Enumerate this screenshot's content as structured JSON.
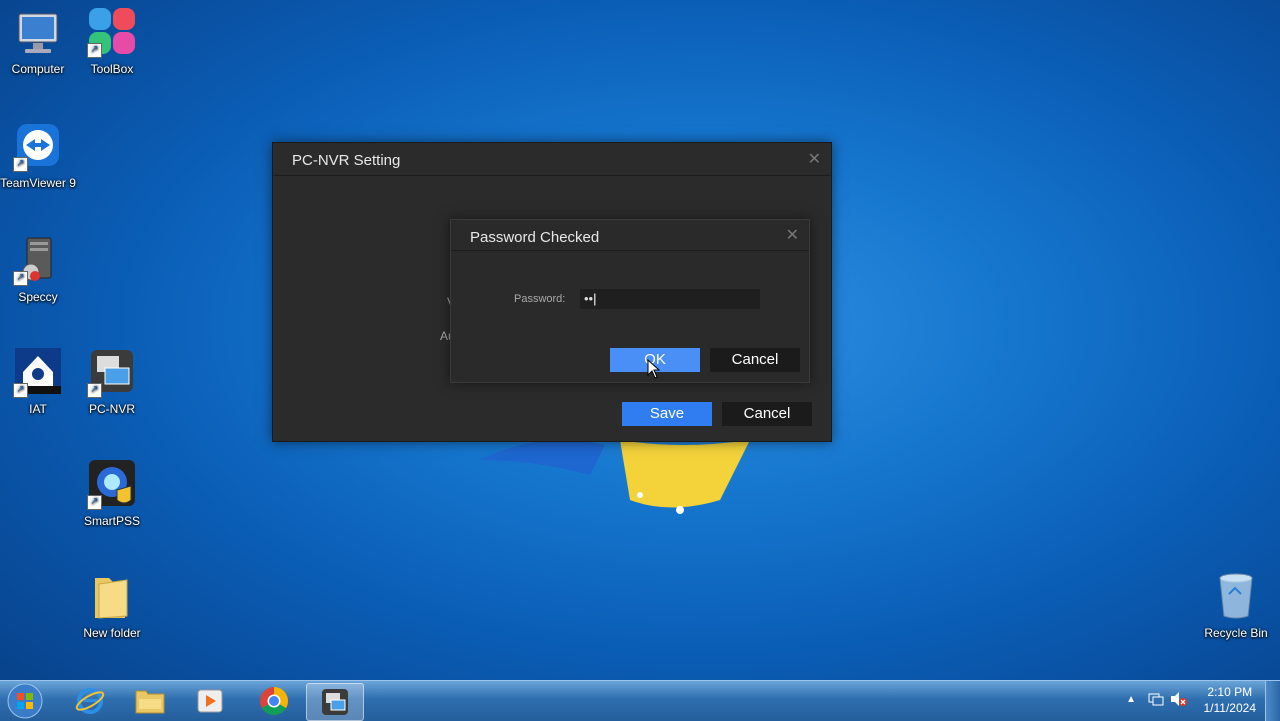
{
  "desktop": {
    "icons": [
      {
        "label": "Computer"
      },
      {
        "label": "ToolBox"
      },
      {
        "label": "TeamViewer 9"
      },
      {
        "label": "Speccy"
      },
      {
        "label": "IAT"
      },
      {
        "label": "PC-NVR"
      },
      {
        "label": "SmartPSS"
      },
      {
        "label": "New folder"
      },
      {
        "label": "Recycle Bin"
      }
    ]
  },
  "nvr_dialog": {
    "title": "PC-NVR Setting",
    "save_label": "Save",
    "cancel_label": "Cancel",
    "partial_labels": [
      "V",
      "Au"
    ]
  },
  "password_dialog": {
    "title": "Password Checked",
    "password_label": "Password:",
    "password_value": "••",
    "ok_label": "OK",
    "cancel_label": "Cancel"
  },
  "taskbar": {
    "apps": [
      "start-button",
      "internet-explorer",
      "windows-explorer",
      "media-player",
      "chrome",
      "pc-nvr"
    ],
    "active_app": "pc-nvr",
    "time": "2:10 PM",
    "date": "1/11/2024"
  },
  "colors": {
    "accent_blue": "#2f7df0",
    "dialog_bg": "#2b2b2b"
  }
}
